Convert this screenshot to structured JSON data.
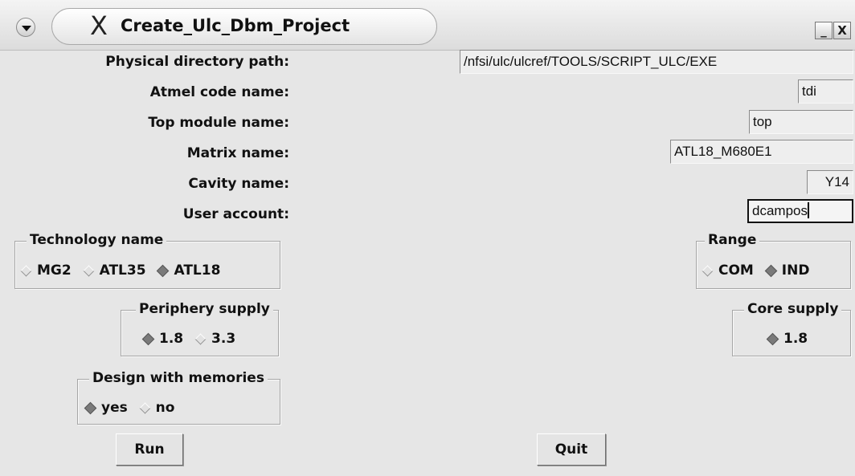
{
  "window": {
    "title": "Create_Ulc_Dbm_Project",
    "x_logo": "X",
    "minimize_glyph": "_",
    "close_glyph": "X"
  },
  "fields": [
    {
      "label": "Physical directory path:",
      "value": "/nfsi/ulc/ulcref/TOOLS/SCRIPT_ULC/EXE"
    },
    {
      "label": "Atmel code name:",
      "value": "tdi"
    },
    {
      "label": "Top module name:",
      "value": "top"
    },
    {
      "label": "Matrix name:",
      "value": "ATL18_M680E1"
    },
    {
      "label": "Cavity name:",
      "value": "Y14"
    },
    {
      "label": "User account:",
      "value": "dcampos"
    }
  ],
  "technology": {
    "title": "Technology name",
    "options": [
      {
        "label": "MG2",
        "selected": false
      },
      {
        "label": "ATL35",
        "selected": false
      },
      {
        "label": "ATL18",
        "selected": true
      }
    ]
  },
  "range": {
    "title": "Range",
    "options": [
      {
        "label": "COM",
        "selected": false
      },
      {
        "label": "IND",
        "selected": true
      }
    ]
  },
  "periphery_supply": {
    "title": "Periphery supply",
    "options": [
      {
        "label": "1.8",
        "selected": true
      },
      {
        "label": "3.3",
        "selected": false
      }
    ]
  },
  "core_supply": {
    "title": "Core supply",
    "options": [
      {
        "label": "1.8",
        "selected": true
      }
    ]
  },
  "memories": {
    "title": "Design with memories",
    "options": [
      {
        "label": "yes",
        "selected": true
      },
      {
        "label": "no",
        "selected": false
      }
    ]
  },
  "buttons": {
    "run": "Run",
    "quit": "Quit"
  },
  "icons": {
    "menu": "window-menu-icon",
    "minimize": "minimize-icon",
    "close": "close-icon",
    "radio_on": "radio-selected-icon",
    "radio_off": "radio-unselected-icon"
  }
}
